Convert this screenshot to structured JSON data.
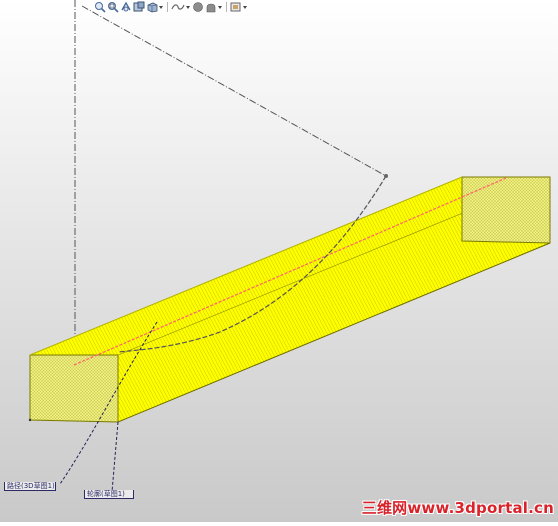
{
  "toolbar": {
    "buttons": [
      {
        "name": "zoom-to-fit-icon"
      },
      {
        "name": "zoom-to-area-icon"
      },
      {
        "name": "previous-view-icon"
      },
      {
        "name": "section-view-icon"
      },
      {
        "name": "view-orientation-icon"
      },
      {
        "name": "display-style-icon"
      },
      {
        "name": "hide-show-items-icon"
      },
      {
        "name": "edit-appearance-icon"
      },
      {
        "name": "apply-scene-icon"
      },
      {
        "name": "view-settings-icon"
      }
    ]
  },
  "annotations": {
    "path_tag": "路径(3D草图1)",
    "sketch_tag": "轮廓(草图1)"
  },
  "watermark": {
    "chinese": "三维网",
    "url": "www.3dportal.cn"
  },
  "colors": {
    "sweep_body": "#ffff00",
    "edge_dark": "#8c8c00",
    "path_curve": "#ff6a6a",
    "construction_line": "#555555",
    "watermark": "#d8232a"
  }
}
